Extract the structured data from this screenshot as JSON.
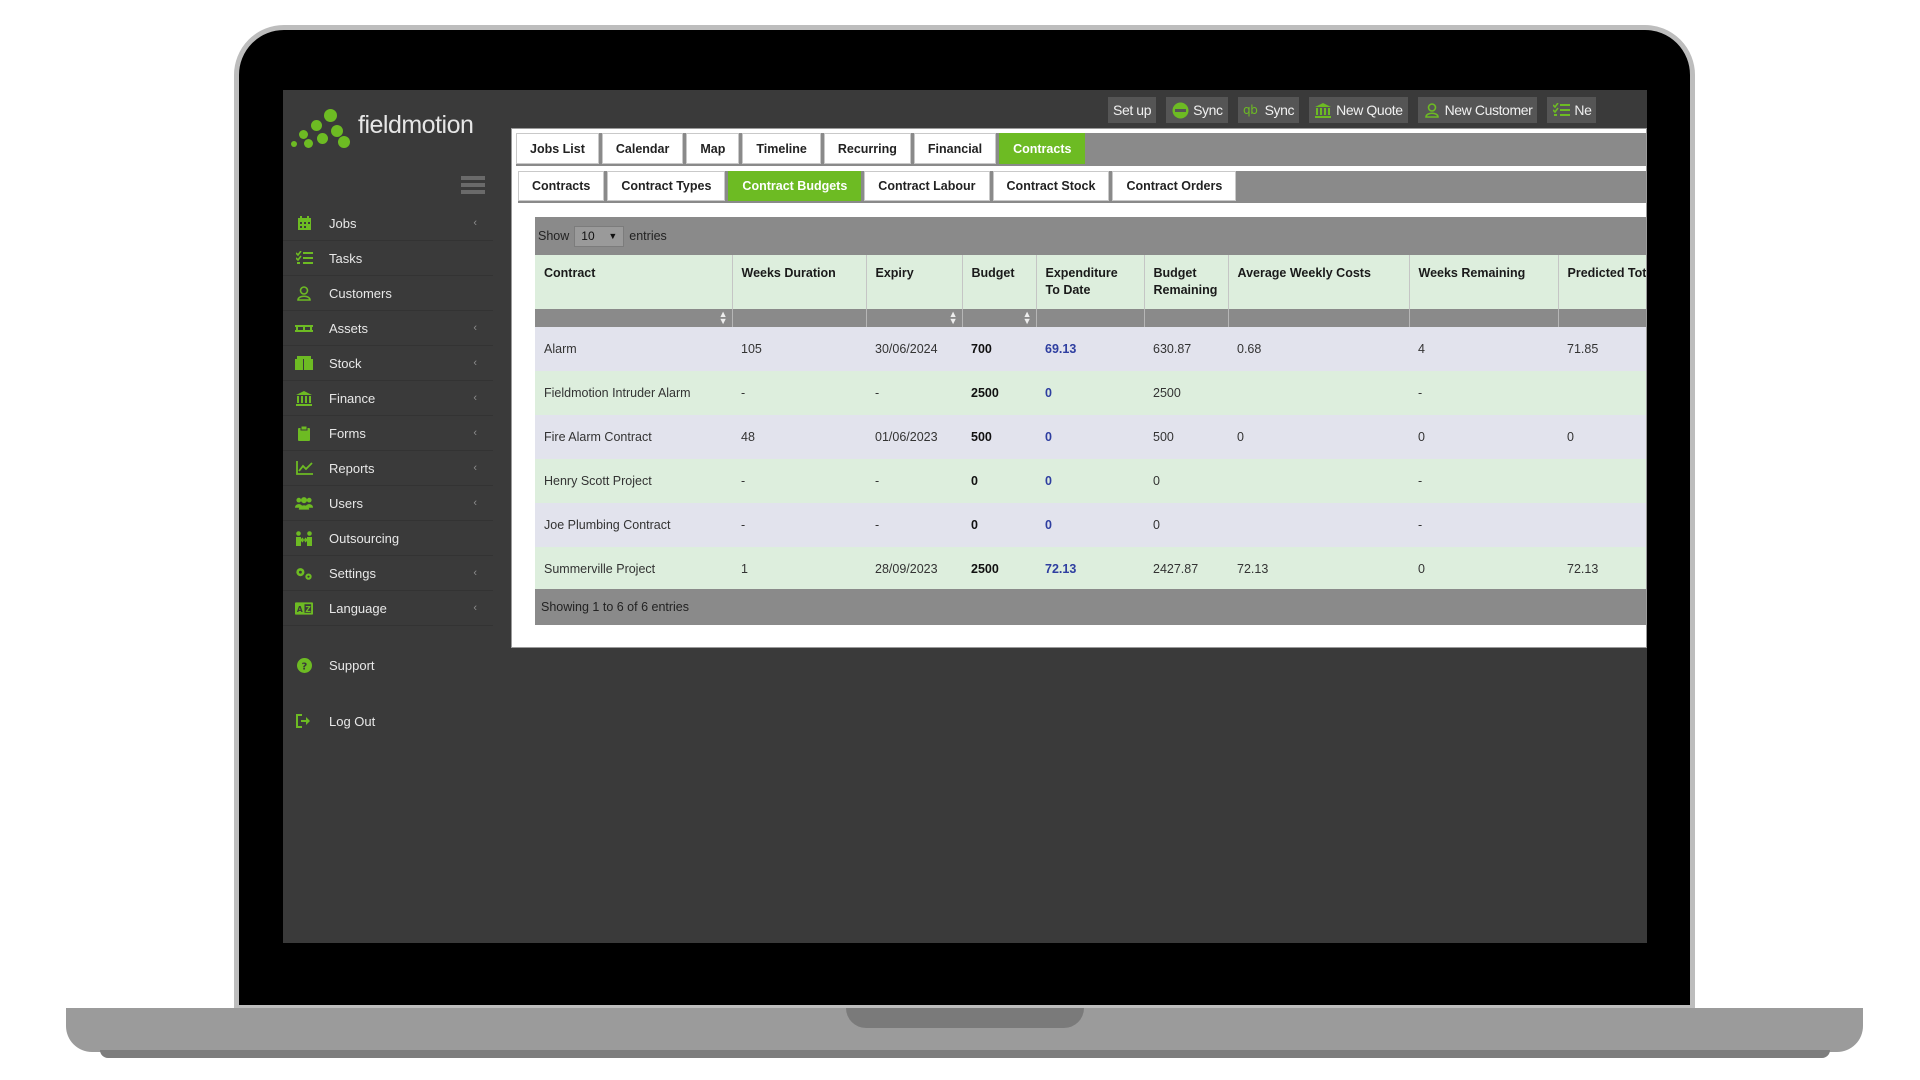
{
  "app": {
    "logo_text": "fieldmotion"
  },
  "colors": {
    "brand_green": "#6dbb23",
    "sidebar_bg": "#3a3a3a",
    "link_blue": "#2e3ea0"
  },
  "topbar": {
    "setup": "Set up",
    "sync1": "Sync",
    "sync2": "Sync",
    "new_quote": "New Quote",
    "new_customer": "New Customer",
    "new_more": "Ne"
  },
  "sidebar": {
    "items": [
      {
        "label": "Jobs",
        "icon": "calendar-icon",
        "has_sub": true
      },
      {
        "label": "Tasks",
        "icon": "list-check-icon",
        "has_sub": false
      },
      {
        "label": "Customers",
        "icon": "user-icon",
        "has_sub": false
      },
      {
        "label": "Assets",
        "icon": "pallet-icon",
        "has_sub": true
      },
      {
        "label": "Stock",
        "icon": "boxes-icon",
        "has_sub": true
      },
      {
        "label": "Finance",
        "icon": "bank-icon",
        "has_sub": true
      },
      {
        "label": "Forms",
        "icon": "clipboard-icon",
        "has_sub": true
      },
      {
        "label": "Reports",
        "icon": "line-chart-icon",
        "has_sub": true
      },
      {
        "label": "Users",
        "icon": "users-icon",
        "has_sub": true
      },
      {
        "label": "Outsourcing",
        "icon": "people-arrows-icon",
        "has_sub": false
      },
      {
        "label": "Settings",
        "icon": "gears-icon",
        "has_sub": true
      },
      {
        "label": "Language",
        "icon": "language-icon",
        "has_sub": true
      }
    ],
    "support": "Support",
    "logout": "Log Out"
  },
  "tabs_primary": [
    "Jobs List",
    "Calendar",
    "Map",
    "Timeline",
    "Recurring",
    "Financial",
    "Contracts"
  ],
  "tabs_secondary": [
    "Contracts",
    "Contract Types",
    "Contract Budgets",
    "Contract Labour",
    "Contract Stock",
    "Contract Orders"
  ],
  "table": {
    "length_show": "Show",
    "length_value": "10",
    "length_entries": "entries",
    "columns": [
      "Contract",
      "Weeks Duration",
      "Expiry",
      "Budget",
      "Expenditure To Date",
      "Budget Remaining",
      "Average Weekly Costs",
      "Weeks Remaining",
      "Predicted Tota"
    ],
    "rows": [
      [
        "Alarm",
        "105",
        "30/06/2024",
        "700",
        "69.13",
        "630.87",
        "0.68",
        "4",
        "71.85"
      ],
      [
        "Fieldmotion Intruder Alarm",
        "-",
        "-",
        "2500",
        "0",
        "2500",
        "",
        "-",
        ""
      ],
      [
        "Fire Alarm Contract",
        "48",
        "01/06/2023",
        "500",
        "0",
        "500",
        "0",
        "0",
        "0"
      ],
      [
        "Henry Scott Project",
        "-",
        "-",
        "0",
        "0",
        "0",
        "",
        "-",
        ""
      ],
      [
        "Joe Plumbing Contract",
        "-",
        "-",
        "0",
        "0",
        "0",
        "",
        "-",
        ""
      ],
      [
        "Summerville Project",
        "1",
        "28/09/2023",
        "2500",
        "72.13",
        "2427.87",
        "72.13",
        "0",
        "72.13"
      ]
    ],
    "info": "Showing 1 to 6 of 6 entries"
  }
}
